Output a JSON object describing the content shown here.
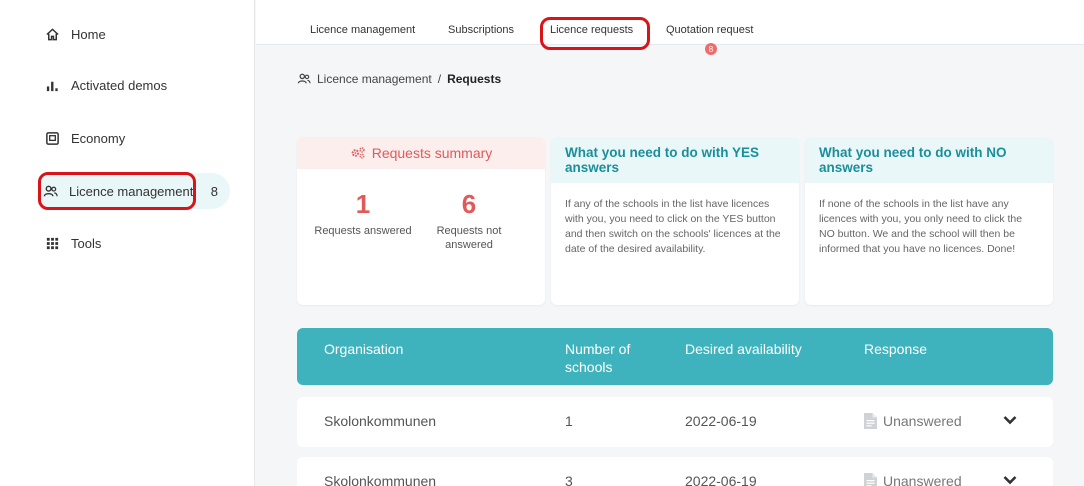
{
  "sidebar": {
    "items": [
      {
        "label": "Home",
        "icon": "home-icon"
      },
      {
        "label": "Activated demos",
        "icon": "bar-chart-icon"
      },
      {
        "label": "Economy",
        "icon": "calculator-icon"
      },
      {
        "label": "Licence management",
        "icon": "users-icon",
        "badge": "8"
      },
      {
        "label": "Tools",
        "icon": "grid-icon"
      }
    ]
  },
  "tabs": {
    "items": [
      "Licence management",
      "Subscriptions",
      "Licence requests",
      "Quotation request"
    ],
    "quotation_badge": "8"
  },
  "breadcrumb": {
    "parent": "Licence management",
    "separator": "/",
    "current": "Requests"
  },
  "summary": {
    "title": "Requests summary",
    "answered_count": "1",
    "answered_label": "Requests answered",
    "not_answered_count": "6",
    "not_answered_label": "Requests not answered"
  },
  "yes_card": {
    "title": "What you need to do with YES answers",
    "body": "If any of the schools in the list have licences with you, you need to click on the YES button and then switch on the schools' licences at the date of the desired availability."
  },
  "no_card": {
    "title": "What you need to do with NO answers",
    "body": "If none of the schools in the list have any licences with you, you only need to click the NO button. We and the school will then be informed that you have no licences. Done!"
  },
  "table": {
    "headers": {
      "organisation": "Organisation",
      "schools": "Number of schools",
      "availability": "Desired availability",
      "response": "Response"
    },
    "rows": [
      {
        "organisation": "Skolonkommunen",
        "schools": "1",
        "availability": "2022-06-19",
        "response": "Unanswered"
      },
      {
        "organisation": "Skolonkommunen",
        "schools": "3",
        "availability": "2022-06-19",
        "response": "Unanswered"
      }
    ]
  },
  "colors": {
    "accent": "#3fb3bd",
    "summary": "#e05a5a",
    "highlight": "#d8141a",
    "badge": "#f06b6b"
  }
}
